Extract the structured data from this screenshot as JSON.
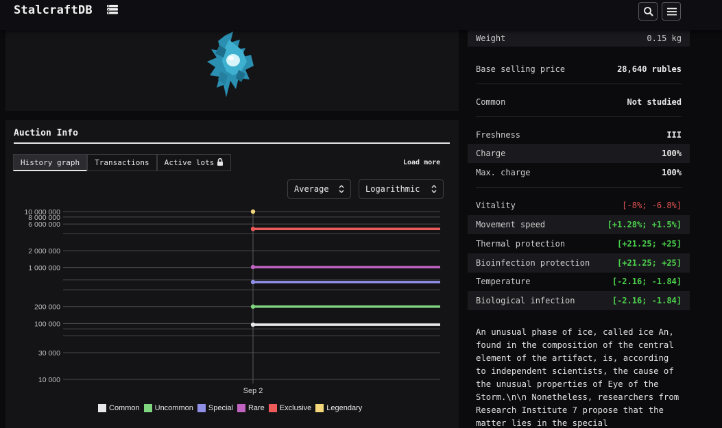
{
  "header": {
    "brand": "StalcraftDB",
    "icons": [
      "database-icon",
      "search-icon",
      "menu-icon"
    ]
  },
  "auction": {
    "title": "Auction Info",
    "tabs": [
      {
        "label": "History graph",
        "active": true
      },
      {
        "label": "Transactions",
        "active": false
      },
      {
        "label": "Active lots",
        "active": false
      }
    ],
    "load_more": "Load more",
    "mode_select": "Average",
    "scale_select": "Logarithmic"
  },
  "chart_data": {
    "type": "line",
    "title": "",
    "xlabel": "",
    "ylabel": "",
    "scale": "log",
    "ylim": [
      10000,
      10000000
    ],
    "y_ticks": [
      {
        "value": 10000000,
        "label": "10 000 000"
      },
      {
        "value": 8000000,
        "label": "8 000 000"
      },
      {
        "value": 6000000,
        "label": "6 000 000"
      },
      {
        "value": 4000000,
        "label": ""
      },
      {
        "value": 2000000,
        "label": "2 000 000"
      },
      {
        "value": 1000000,
        "label": "1 000 000"
      },
      {
        "value": 600000,
        "label": ""
      },
      {
        "value": 400000,
        "label": ""
      },
      {
        "value": 200000,
        "label": "200 000"
      },
      {
        "value": 100000,
        "label": "100 000"
      },
      {
        "value": 80000,
        "label": ""
      },
      {
        "value": 60000,
        "label": ""
      },
      {
        "value": 30000,
        "label": "30 000"
      },
      {
        "value": 10000,
        "label": "10 000"
      }
    ],
    "x_tick": "Sep 2",
    "series": [
      {
        "name": "Common",
        "color": "#e8e8e8",
        "value": 95000
      },
      {
        "name": "Uncommon",
        "color": "#7fd67f",
        "value": 200000
      },
      {
        "name": "Special",
        "color": "#8f8fe6",
        "value": 550000
      },
      {
        "name": "Rare",
        "color": "#c063c0",
        "value": 1020000
      },
      {
        "name": "Exclusive",
        "color": "#ec5a5a",
        "value": 4900000
      },
      {
        "name": "Legendary",
        "color": "#f4d77a",
        "value": 10000000,
        "point_only": true
      }
    ],
    "legend_position": "bottom"
  },
  "stats": {
    "weight": {
      "label": "Weight",
      "value": "0.15 kg"
    },
    "base_price": {
      "label": "Base selling price",
      "value": "28,640 rubles"
    },
    "common": {
      "label": "Common",
      "value": "Not studied"
    },
    "freshness": {
      "label": "Freshness",
      "value": "III"
    },
    "charge": {
      "label": "Charge",
      "value": "100%"
    },
    "max_charge": {
      "label": "Max. charge",
      "value": "100%"
    },
    "vitality": {
      "label": "Vitality",
      "value": "[-8%; -6.8%]"
    },
    "movement": {
      "label": "Movement speed",
      "value": "[+1.28%; +1.5%]"
    },
    "thermal": {
      "label": "Thermal protection",
      "value": "[+21.25; +25]"
    },
    "bioinfection": {
      "label": "Bioinfection protection",
      "value": "[+21.25; +25]"
    },
    "temperature": {
      "label": "Temperature",
      "value": "[-2.16; -1.84]"
    },
    "bio_infection": {
      "label": "Biological infection",
      "value": "[-2.16; -1.84]"
    }
  },
  "description": "An unusual phase of ice, called ice An, found in the composition of the central element of the artifact, is, according to independent scientists, the cause of the unusual properties of Eye of the Storm.\\n\\n Nonetheless, researchers from Research Institute 7 propose that the matter lies in the special",
  "colors": {
    "negative": "#e05252",
    "positive": "#4cd14c",
    "accent": "#e8e8e8"
  }
}
